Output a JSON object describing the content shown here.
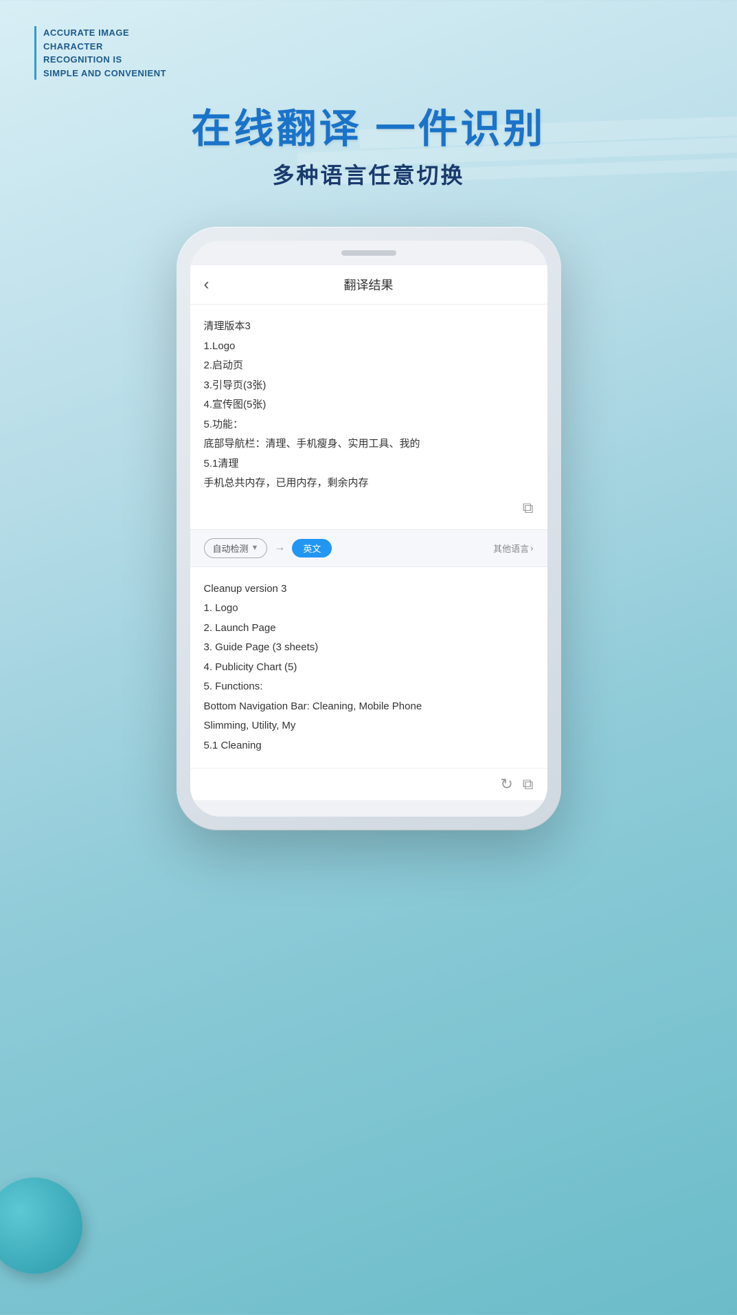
{
  "background": {
    "gradient_start": "#d8eef5",
    "gradient_end": "#6bbcc9"
  },
  "tagline": {
    "line1": "ACCURATE IMAGE",
    "line2": "CHARACTER",
    "line3": "RECOGNITION IS",
    "line4": "SIMPLE AND CONVENIENT"
  },
  "headline": {
    "main": "在线翻译 一件识别",
    "sub": "多种语言任意切换"
  },
  "app": {
    "nav_back": "‹",
    "nav_title": "翻译结果",
    "original_lines": [
      "清理版本3",
      "1.Logo",
      "2.启动页",
      "3.引导页(3张)",
      "4.宣传图(5张)",
      "5.功能：",
      "底部导航栏：清理、手机瘦身、实用工具、我的",
      "5.1清理",
      "手机总共内存，已用内存，剩余内存"
    ],
    "copy_icon": "⧉",
    "lang_auto": "自动检测",
    "lang_auto_arrow": "▼",
    "arrow_right": "→",
    "lang_en": "英文",
    "lang_more": "其他语言",
    "lang_more_arrow": "›",
    "translated_lines": [
      "Cleanup version 3",
      "1. Logo",
      "2. Launch Page",
      "3. Guide Page (3 sheets)",
      "4. Publicity Chart (5)",
      "5. Functions:",
      "Bottom Navigation Bar: Cleaning, Mobile Phone",
      "Slimming, Utility, My",
      "5.1 Cleaning"
    ],
    "refresh_icon": "↻",
    "copy_icon2": "⧉"
  }
}
